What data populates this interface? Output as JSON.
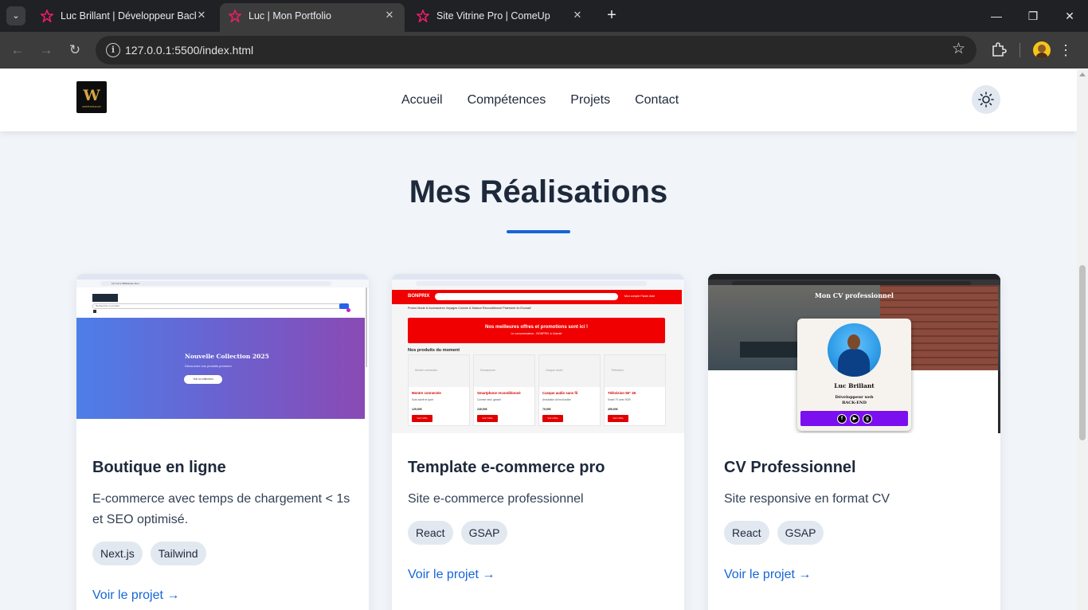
{
  "browser": {
    "tabs": [
      {
        "title": "Luc Brillant | Développeur Backend",
        "active": false
      },
      {
        "title": "Luc | Mon Portfolio",
        "active": true
      },
      {
        "title": "Site Vitrine Pro | ComeUp",
        "active": false
      }
    ],
    "url": "127.0.0.1:5500/index.html",
    "accent_favicon_color": "#e91e63"
  },
  "site": {
    "logo_text": "W",
    "logo_subtext": "webfreelance",
    "nav": [
      "Accueil",
      "Compétences",
      "Projets",
      "Contact"
    ],
    "theme_icon": "sun-icon"
  },
  "section": {
    "title": "Mes Réalisations",
    "accent_color": "#1565d8"
  },
  "projects": [
    {
      "title": "Boutique en ligne",
      "description": "E-commerce avec temps de chargement < 1s et SEO optimisé.",
      "tags": [
        "Next.js",
        "Tailwind"
      ],
      "link": "Voir le projet →",
      "preview": {
        "hero_title": "Nouvelle Collection 2025",
        "hero_subtitle": "Découvrez nos produits premium",
        "hero_button": "Voir la collection",
        "search_placeholder": "Rechercher un produit",
        "url": "127.0.0.1:5500/index.html"
      }
    },
    {
      "title": "Template e-commerce pro",
      "description": "Site e-commerce professionnel",
      "tags": [
        "React",
        "GSAP"
      ],
      "link": "Voir le projet →",
      "preview": {
        "brand": "BONPRIX",
        "links": "Mon compte   Panier   Aide",
        "categories": "Promo   Mode & Accessoires   Voyages   Cuisine & Maison   Reconditionné   Paiement 4x   Exclusif",
        "banner_title": "Nos meilleures offres et promotions sont ici !",
        "banner_subtitle": "Le consommateur - BONPRIX à Volonté",
        "products_heading": "Nos produits du moment",
        "products": [
          {
            "image_alt": "Montre connectée",
            "name": "Montre connectée",
            "desc": "Suivi santé et sport",
            "price": "129,90€",
            "button": "Voir l'offre"
          },
          {
            "image_alt": "Smartphone",
            "name": "Smartphone reconditionné",
            "desc": "Comme neuf, garanti",
            "price": "249,90€",
            "button": "Voir l'offre"
          },
          {
            "image_alt": "Casque audio",
            "name": "Casque audio sans fil",
            "desc": "Annulation de bruit active",
            "price": "79,90€",
            "button": "Voir l'offre"
          },
          {
            "image_alt": "Télévision",
            "name": "Télévision 55\" 4K",
            "desc": "Smart TV avec HDR",
            "price": "499,90€",
            "button": "Voir l'offre"
          }
        ]
      }
    },
    {
      "title": "CV Professionnel",
      "description": "Site responsive en format CV",
      "tags": [
        "React",
        "GSAP"
      ],
      "link": "Voir le projet →",
      "preview": {
        "page_title": "Mon CV professionnel",
        "name": "Luc Brillant",
        "role_line1": "Développeur web",
        "role_line2": "BACK-END",
        "socials": [
          "f",
          "▶",
          "g"
        ]
      }
    }
  ]
}
